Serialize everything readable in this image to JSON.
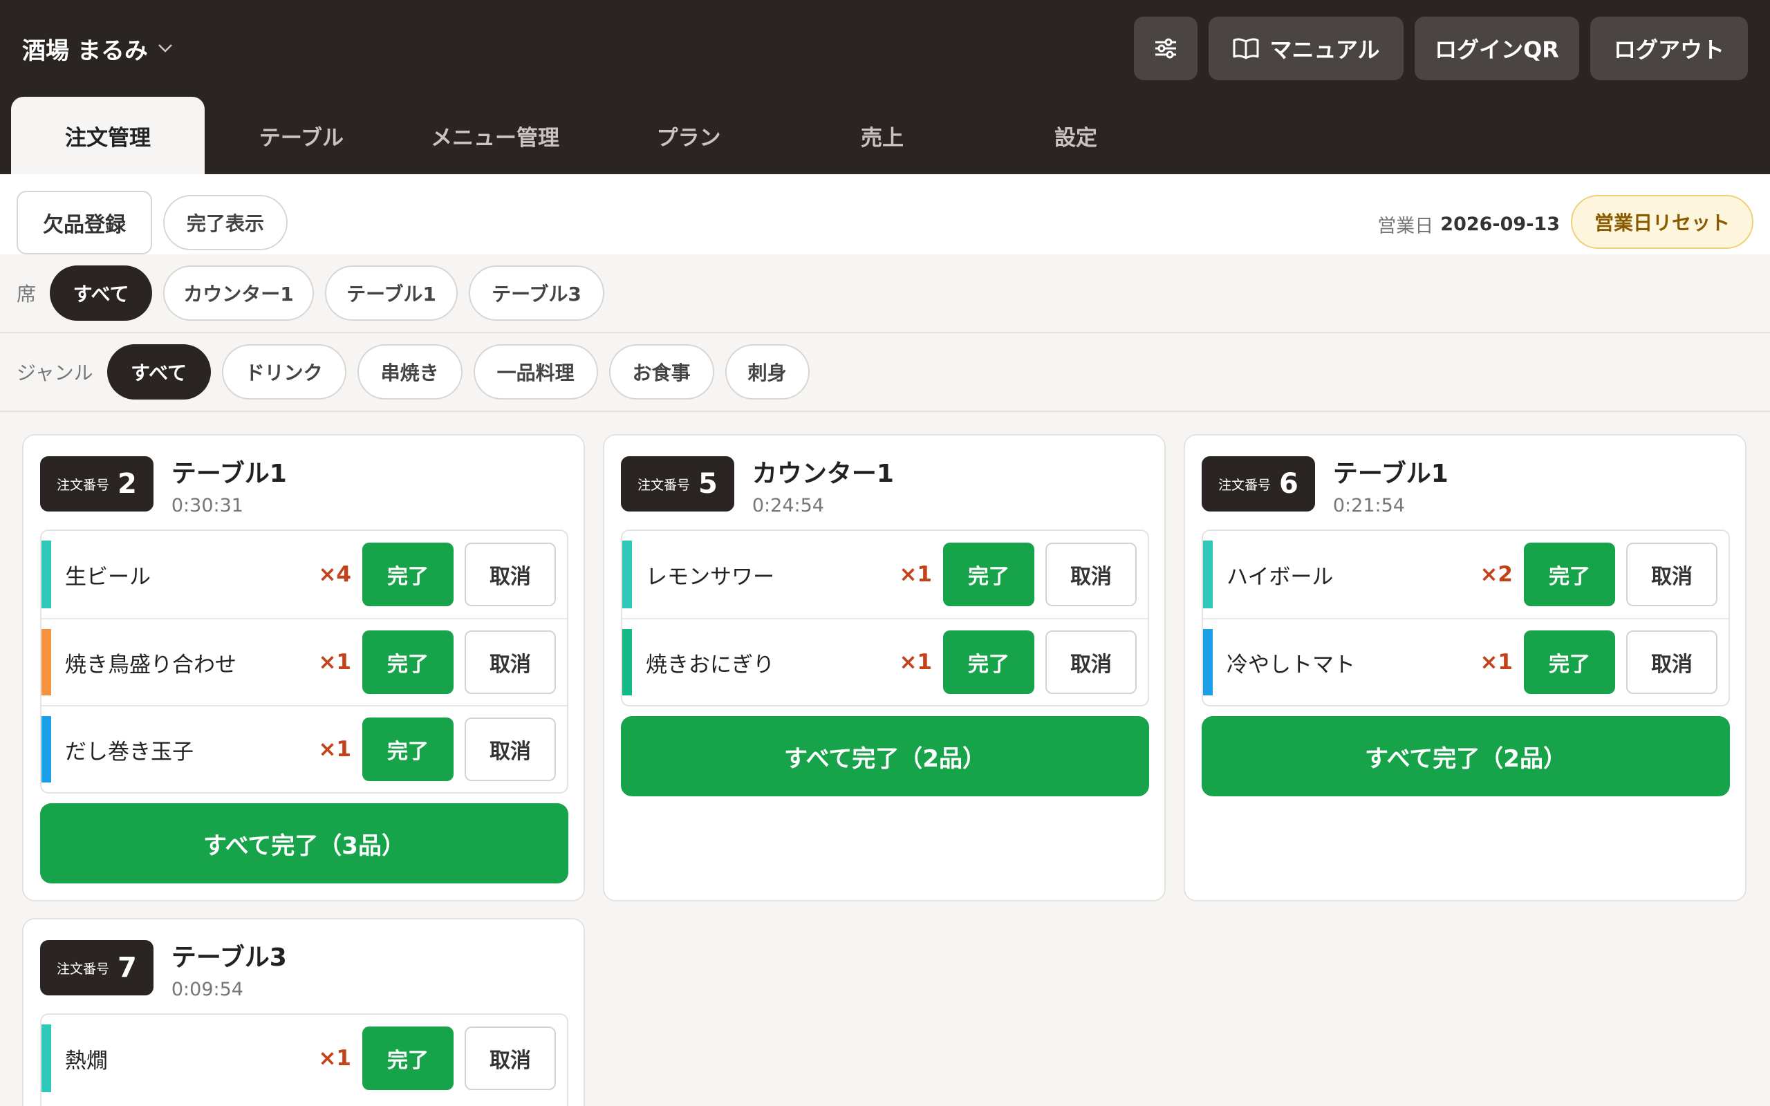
{
  "header": {
    "shop_name": "酒場 まるみ",
    "buttons": {
      "manual": "マニュアル",
      "login_qr": "ログインQR",
      "logout": "ログアウト"
    }
  },
  "tabs": [
    "注文管理",
    "テーブル",
    "メニュー管理",
    "プラン",
    "売上",
    "設定"
  ],
  "toolbar": {
    "missing_register": "欠品登録",
    "show_done": "完了表示",
    "business_day_label": "営業日",
    "business_day": "2026-09-13",
    "reset_label": "営業日リセット"
  },
  "seat_filter": {
    "label": "席",
    "options": [
      "すべて",
      "カウンター1",
      "テーブル1",
      "テーブル3"
    ]
  },
  "genre_filter": {
    "label": "ジャンル",
    "options": [
      "すべて",
      "ドリンク",
      "串焼き",
      "一品料理",
      "お食事",
      "刺身"
    ]
  },
  "labels": {
    "order_number": "注文番号",
    "done": "完了",
    "cancel": "取消"
  },
  "colors": {
    "teal": "#2ec9b8",
    "orange": "#f5923e",
    "blue": "#1aa0e8",
    "green": "#12b886"
  },
  "orders": [
    {
      "number": "2",
      "seat": "テーブル1",
      "elapsed": "0:30:31",
      "complete_all": "すべて完了（3品）",
      "items": [
        {
          "name": "生ビール",
          "qty": "×4",
          "color": "#2ec9b8"
        },
        {
          "name": "焼き鳥盛り合わせ",
          "qty": "×1",
          "color": "#f5923e"
        },
        {
          "name": "だし巻き玉子",
          "qty": "×1",
          "color": "#1aa0e8"
        }
      ]
    },
    {
      "number": "5",
      "seat": "カウンター1",
      "elapsed": "0:24:54",
      "complete_all": "すべて完了（2品）",
      "items": [
        {
          "name": "レモンサワー",
          "qty": "×1",
          "color": "#2ec9b8"
        },
        {
          "name": "焼きおにぎり",
          "qty": "×1",
          "color": "#12b886"
        }
      ]
    },
    {
      "number": "6",
      "seat": "テーブル1",
      "elapsed": "0:21:54",
      "complete_all": "すべて完了（2品）",
      "items": [
        {
          "name": "ハイボール",
          "qty": "×2",
          "color": "#2ec9b8"
        },
        {
          "name": "冷やしトマト",
          "qty": "×1",
          "color": "#1aa0e8"
        }
      ]
    },
    {
      "number": "7",
      "seat": "テーブル3",
      "elapsed": "0:09:54",
      "items": [
        {
          "name": "熱燗",
          "qty": "×1",
          "color": "#2ec9b8"
        }
      ]
    }
  ]
}
